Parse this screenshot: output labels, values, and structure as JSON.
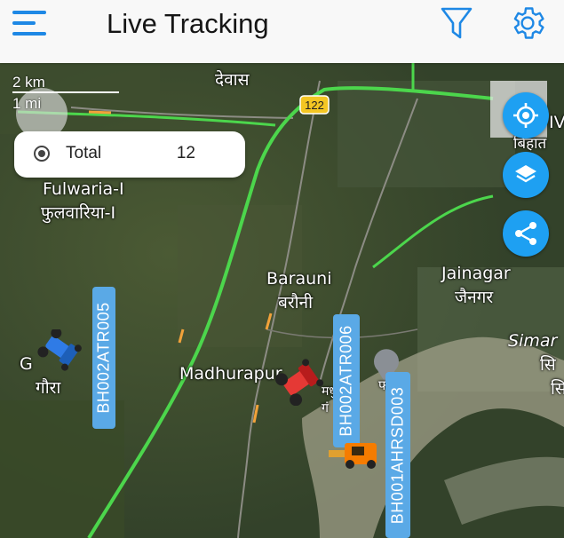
{
  "header": {
    "title": "Live Tracking",
    "accent": "#1e88e5"
  },
  "map": {
    "scale": {
      "km": "2 km",
      "mi": "1 mi"
    },
    "road_badge": "122",
    "places": [
      {
        "name": "देवास"
      },
      {
        "name": "Fulwaria-I"
      },
      {
        "name": "फुलवारिया-I"
      },
      {
        "name": "Barauni"
      },
      {
        "name": "बरौनी"
      },
      {
        "name": "Jainagar"
      },
      {
        "name": "जैनगर"
      },
      {
        "name": "Madhurapur"
      },
      {
        "name": "Simar"
      },
      {
        "name": "सि"
      },
      {
        "name": "सि"
      },
      {
        "name": "गौरा"
      },
      {
        "name": "G"
      },
      {
        "name": "बिहात"
      },
      {
        "name": "IV"
      },
      {
        "name": "मधु"
      },
      {
        "name": "गं"
      },
      {
        "name": "फ"
      }
    ]
  },
  "summary": {
    "label": "Total",
    "count": "12"
  },
  "actions": [
    {
      "name": "my-location-icon"
    },
    {
      "name": "layers-icon"
    },
    {
      "name": "share-icon"
    }
  ],
  "vehicles": [
    {
      "id": "BH002ATR005",
      "color": "#2f7be6"
    },
    {
      "id": "BH002ATR006",
      "color": "#e53935"
    },
    {
      "id": "BH001AHRSD003",
      "color": "#f57c00"
    }
  ]
}
